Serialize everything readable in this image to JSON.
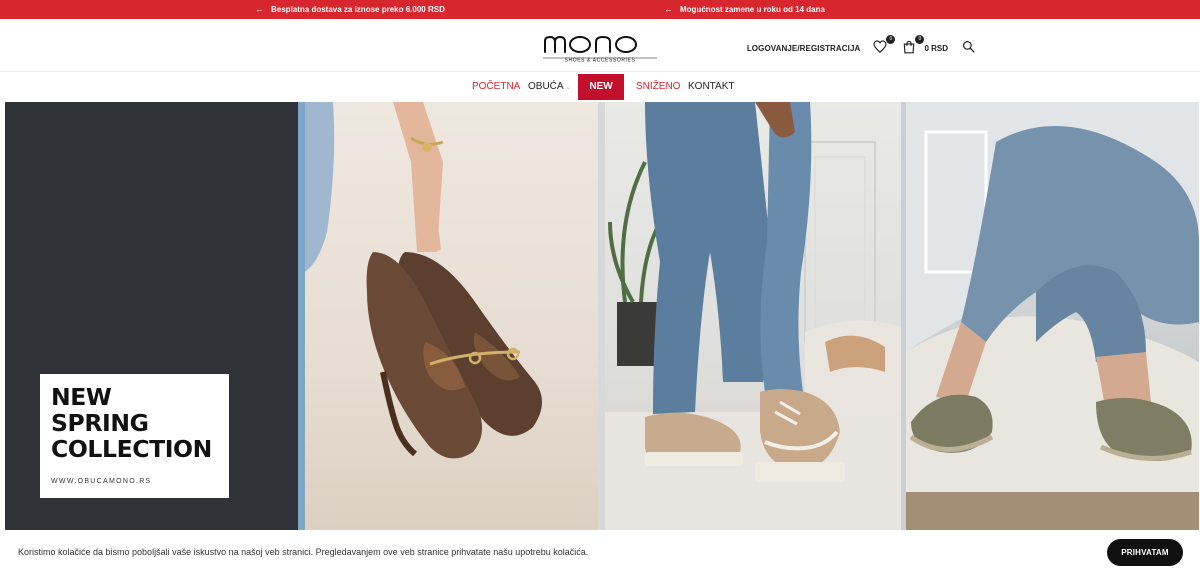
{
  "topbar": {
    "promo_left": "Besplatna dostava za iznose preko 6.000 RSD",
    "promo_right": "Mogućnost zamene u roku od 14 dana",
    "arrow_icon": "arrow-left-icon",
    "bg_color": "#d8262f"
  },
  "header": {
    "logo_text": "mono",
    "logo_tagline": "SHOES & ACCESSORIES",
    "login_label": "LOGOVANJE/REGISTRACIJA",
    "wishlist_count": "0",
    "cart_count": "0",
    "cart_total": "0 RSD",
    "icons": [
      "heart-icon",
      "shopping-bag-icon",
      "search-icon"
    ]
  },
  "nav": {
    "items": [
      {
        "label": "POČETNA",
        "active": true
      },
      {
        "label": "OBUĆA",
        "has_dropdown": true
      },
      {
        "label": "NEW",
        "highlight": true
      },
      {
        "label": "SNIŽENO",
        "color": "#d8262f"
      },
      {
        "label": "KONTAKT"
      }
    ],
    "accent_color": "#c2102c"
  },
  "hero": {
    "title_lines": [
      "NEW",
      "SPRING",
      "COLLECTION"
    ],
    "url": "WWW.OBUCAMONO.RS"
  },
  "cookie": {
    "text": "Koristimo kolačiće da bismo poboljšali vaše iskustvo na našoj veb stranici. Pregledavanjem ove veb stranice prihvatate našu upotrebu kolačića.",
    "accept_label": "PRIHVATAM"
  }
}
